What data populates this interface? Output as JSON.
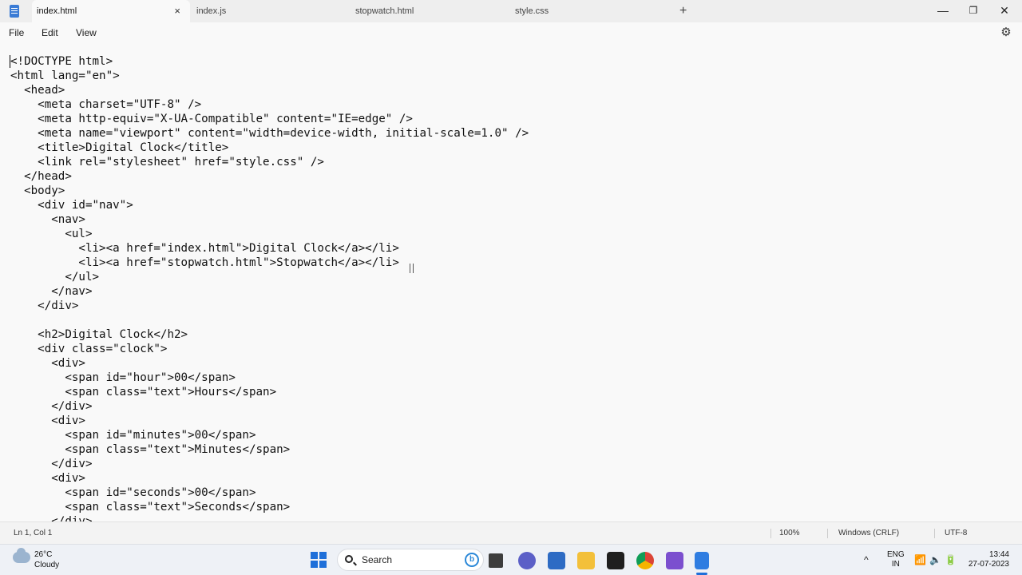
{
  "tabs": [
    {
      "label": "index.html",
      "active": true
    },
    {
      "label": "index.js",
      "active": false
    },
    {
      "label": "stopwatch.html",
      "active": false
    },
    {
      "label": "style.css",
      "active": false
    }
  ],
  "tab_close_glyph": "×",
  "new_tab_glyph": "+",
  "window_controls": {
    "minimize": "—",
    "maximize": "❐",
    "close": "✕"
  },
  "menu": {
    "file": "File",
    "edit": "Edit",
    "view": "View",
    "settings_icon": "gear-icon"
  },
  "editor": {
    "lines": [
      "<!DOCTYPE html>",
      "<html lang=\"en\">",
      "  <head>",
      "    <meta charset=\"UTF-8\" />",
      "    <meta http-equiv=\"X-UA-Compatible\" content=\"IE=edge\" />",
      "    <meta name=\"viewport\" content=\"width=device-width, initial-scale=1.0\" />",
      "    <title>Digital Clock</title>",
      "    <link rel=\"stylesheet\" href=\"style.css\" />",
      "  </head>",
      "  <body>",
      "    <div id=\"nav\">",
      "      <nav>",
      "        <ul>",
      "          <li><a href=\"index.html\">Digital Clock</a></li>",
      "          <li><a href=\"stopwatch.html\">Stopwatch</a></li>",
      "        </ul>",
      "      </nav>",
      "    </div>",
      "",
      "    <h2>Digital Clock</h2>",
      "    <div class=\"clock\">",
      "      <div>",
      "        <span id=\"hour\">00</span>",
      "        <span class=\"text\">Hours</span>",
      "      </div>",
      "      <div>",
      "        <span id=\"minutes\">00</span>",
      "        <span class=\"text\">Minutes</span>",
      "      </div>",
      "      <div>",
      "        <span id=\"seconds\">00</span>",
      "        <span class=\"text\">Seconds</span>",
      "      </div>"
    ]
  },
  "status": {
    "position": "Ln 1, Col 1",
    "zoom": "100%",
    "line_ending": "Windows (CRLF)",
    "encoding": "UTF-8"
  },
  "taskbar": {
    "weather_temp": "26°C",
    "weather_desc": "Cloudy",
    "search_label": "Search",
    "bing_glyph": "b",
    "lang_top": "ENG",
    "lang_bottom": "IN",
    "time": "13:44",
    "date": "27-07-2023",
    "tray_chevron": "^",
    "tray_wifi": "wifi-icon",
    "tray_volume": "volume-icon",
    "tray_battery": "battery-icon"
  },
  "colors": {
    "accent": "#1e6fd9",
    "titlebar": "#eeeeee",
    "editor_bg": "#f9f9f9"
  }
}
